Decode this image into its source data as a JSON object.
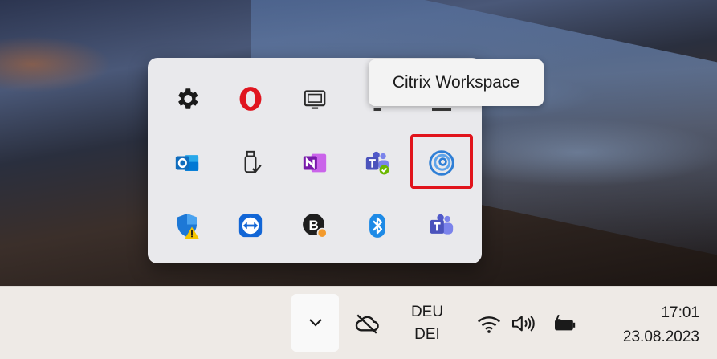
{
  "tooltip": {
    "text": "Citrix Workspace"
  },
  "tray_icons": [
    {
      "name": "settings-icon"
    },
    {
      "name": "opera-icon"
    },
    {
      "name": "display-icon"
    },
    {
      "name": "hidden-icon"
    },
    {
      "name": "hidden-icon"
    },
    {
      "name": "outlook-icon"
    },
    {
      "name": "usb-safely-remove-icon"
    },
    {
      "name": "onenote-icon"
    },
    {
      "name": "teams-icon"
    },
    {
      "name": "citrix-workspace-icon"
    },
    {
      "name": "windows-security-icon"
    },
    {
      "name": "teamviewer-icon"
    },
    {
      "name": "b-app-icon"
    },
    {
      "name": "bluetooth-icon"
    },
    {
      "name": "teams-classic-icon"
    }
  ],
  "taskbar": {
    "language": {
      "line1": "DEU",
      "line2": "DEI"
    },
    "clock": {
      "time": "17:01",
      "date": "23.08.2023"
    },
    "icons": [
      "chevron-up-icon",
      "cloud-offline-icon",
      "wifi-icon",
      "speaker-icon",
      "battery-charging-icon"
    ]
  },
  "colors": {
    "highlight": "#e1141c",
    "opera": "#e0151f",
    "outlook": "#0f6cbd",
    "onenote": "#7719aa",
    "teams": "#5059c9",
    "citrix": "#2f7fd6",
    "bluetooth": "#1e8ae6",
    "teamviewer": "#1266d6",
    "shield": "#1d78d6",
    "warning": "#f5c400"
  }
}
